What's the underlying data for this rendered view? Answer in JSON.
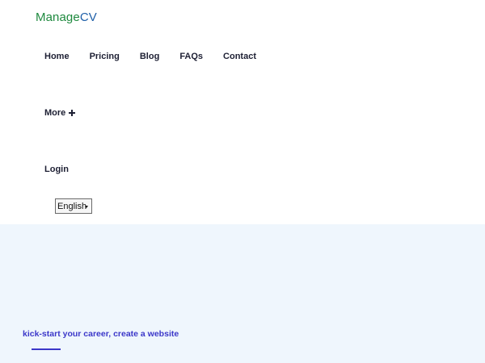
{
  "logo": {
    "part1": "Manage",
    "part2": "CV"
  },
  "nav": {
    "items": [
      {
        "label": "Home"
      },
      {
        "label": "Pricing"
      },
      {
        "label": "Blog"
      },
      {
        "label": "FAQs"
      },
      {
        "label": "Contact"
      }
    ],
    "more_label": "More",
    "login_label": "Login",
    "language": "English"
  },
  "hero": {
    "tagline": "kick-start your career, create a website"
  },
  "colors": {
    "logo_green": "#1f8a3f",
    "logo_blue": "#1e5fa8",
    "accent": "#3b37c9",
    "hero_bg": "#eff6fd"
  }
}
